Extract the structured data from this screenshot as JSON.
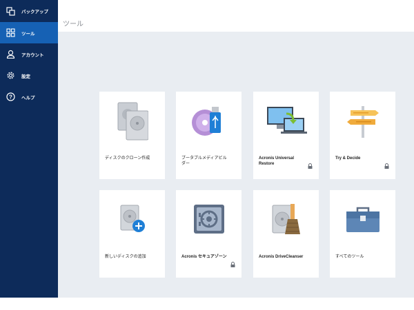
{
  "sidebar": {
    "items": [
      {
        "label": "バックアップ",
        "icon": "backup-icon"
      },
      {
        "label": "ツール",
        "icon": "tools-grid-icon",
        "active": true
      },
      {
        "label": "アカウント",
        "icon": "account-icon"
      },
      {
        "label": "設定",
        "icon": "settings-gear-icon"
      },
      {
        "label": "ヘルプ",
        "icon": "help-icon"
      }
    ]
  },
  "header": {
    "title": "ツール"
  },
  "tiles": [
    {
      "label": "ディスクのクローン作成",
      "icon": "disk-clone-icon",
      "locked": false
    },
    {
      "label": "ブータブルメディアビルダー",
      "icon": "bootable-media-icon",
      "locked": false
    },
    {
      "label": "Acronis Universal Restore",
      "icon": "universal-restore-icon",
      "locked": true
    },
    {
      "label": "Try & Decide",
      "icon": "signpost-icon",
      "locked": true
    },
    {
      "label": "新しいディスクの追加",
      "icon": "add-disk-icon",
      "locked": false
    },
    {
      "label": "Acronis セキュアゾーン",
      "icon": "secure-zone-safe-icon",
      "locked": true
    },
    {
      "label": "Acronis DriveCleanser",
      "icon": "drive-cleanser-icon",
      "locked": false
    },
    {
      "label": "すべてのツール",
      "icon": "toolbox-icon",
      "locked": false
    }
  ],
  "colors": {
    "sidebar_bg": "#0d2b5a",
    "sidebar_active": "#1661b4",
    "main_bg": "#e9edf2",
    "accent": "#1f7fd6"
  }
}
